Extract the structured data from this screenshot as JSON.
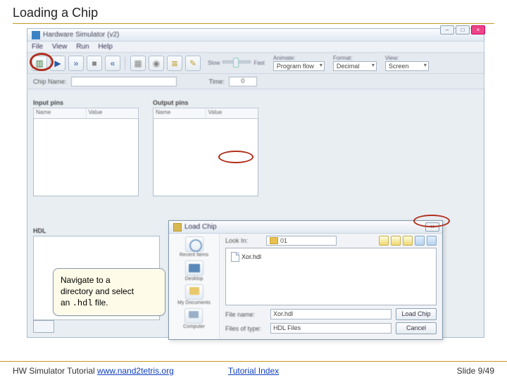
{
  "slide": {
    "title": "Loading a Chip"
  },
  "simwin": {
    "title": "Hardware Simulator (v2)",
    "menu": [
      "File",
      "View",
      "Run",
      "Help"
    ],
    "sys": {
      "min": "–",
      "max": "□",
      "close": "×"
    }
  },
  "toolbar": {
    "speed": {
      "slow": "Slow",
      "fast": "Fast"
    },
    "animate": {
      "label": "Animate:",
      "value": "Program flow"
    },
    "format": {
      "label": "Format:",
      "value": "Decimal"
    },
    "view": {
      "label": "View:",
      "value": "Screen"
    }
  },
  "subbar": {
    "chipname_label": "Chip Name:",
    "time_label": "Time:",
    "time_value": "0"
  },
  "pins": {
    "input_title": "Input pins",
    "output_title": "Output pins",
    "col_name": "Name",
    "col_value": "Value"
  },
  "hdl": {
    "label": "HDL"
  },
  "callout": {
    "l1": "Navigate to a",
    "l2": "directory and select",
    "l3a": "an ",
    "code": ".hdl",
    "l3b": " file."
  },
  "dialog": {
    "title": "Load Chip",
    "close": "×",
    "lookin_label": "Look In:",
    "lookin_value": "01",
    "side": {
      "recent": "Recent Items",
      "desktop": "Desktop",
      "docs": "My Documents",
      "computer": "Computer"
    },
    "file_item": "Xor.hdl",
    "filename_label": "File name:",
    "filename_value": "Xor.hdl",
    "filetype_label": "Files of type:",
    "filetype_value": "HDL Files",
    "btn_open": "Load Chip",
    "btn_cancel": "Cancel"
  },
  "footer": {
    "left_prefix": "HW Simulator Tutorial ",
    "left_link": "www.nand2tetris.org",
    "mid_link": "Tutorial Index",
    "right": "Slide 9/49"
  }
}
